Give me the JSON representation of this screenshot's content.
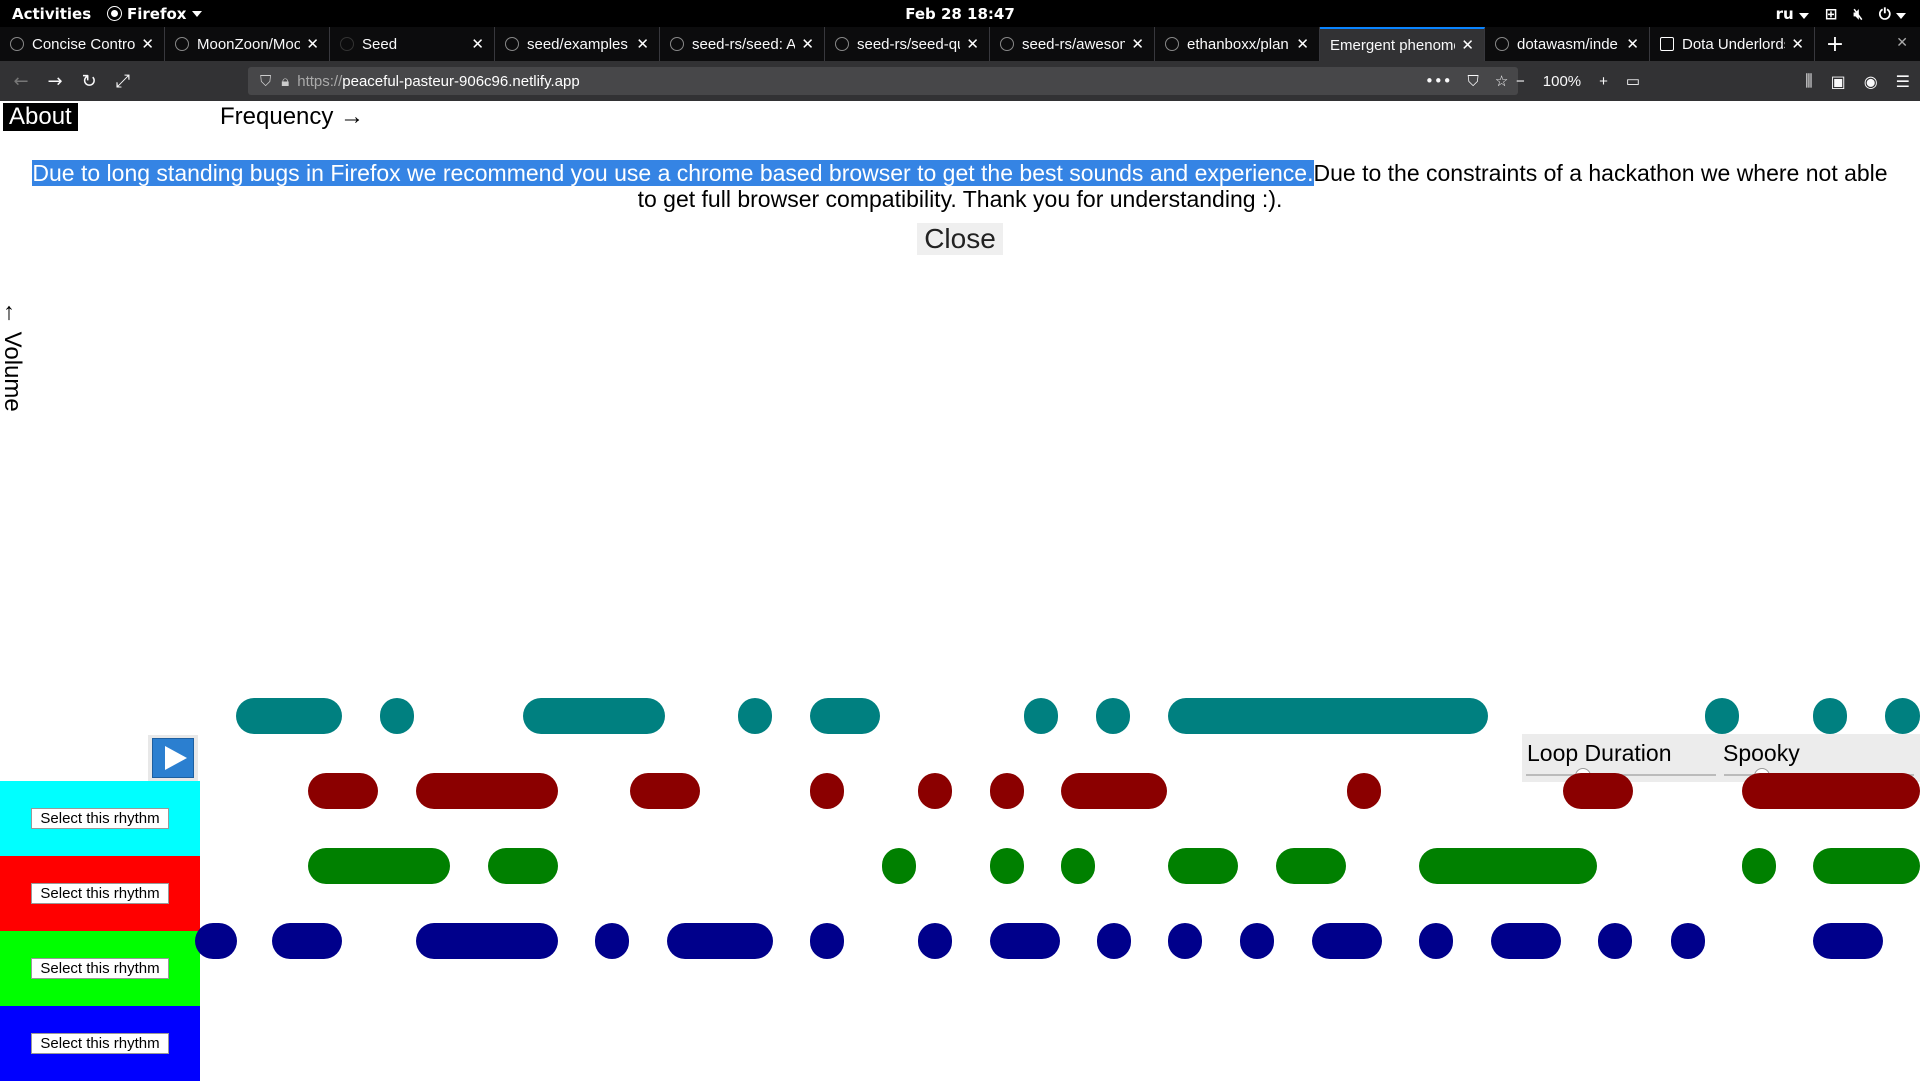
{
  "system_bar": {
    "activities": "Activities",
    "app_name": "Firefox",
    "clock": "Feb 28  18:47",
    "keyboard_layout": "ru"
  },
  "tabs": [
    {
      "title": "Concise Control",
      "active": false
    },
    {
      "title": "MoonZoon/Moo",
      "active": false
    },
    {
      "title": "Seed",
      "active": false
    },
    {
      "title": "seed/examples",
      "active": false
    },
    {
      "title": "seed-rs/seed: A",
      "active": false
    },
    {
      "title": "seed-rs/seed-qu",
      "active": false
    },
    {
      "title": "seed-rs/awesom",
      "active": false
    },
    {
      "title": "ethanboxx/plan",
      "active": false
    },
    {
      "title": "Emergent phenome",
      "active": true
    },
    {
      "title": "dotawasm/inde",
      "active": false
    },
    {
      "title": "Dota Underlords",
      "active": false
    }
  ],
  "address_bar": {
    "protocol": "https://",
    "host": "peaceful-pasteur-906c96.netlify.app",
    "zoom": "100%"
  },
  "page": {
    "about_label": "About",
    "frequency_label": "Frequency →",
    "volume_label": "← Volume",
    "notice_selected": "Due to long standing bugs in Firefox we recommend you use a chrome based browser to get the best sounds and experience.",
    "notice_rest": "Due to the constraints of a hackathon we where not able to get full browser compatibility. Thank you for understanding :).",
    "close_label": "Close",
    "loop_duration_label": "Loop Duration",
    "spooky_label": "Spooky",
    "loop_duration_value": 0.3,
    "spooky_value": 0.2
  },
  "rhythms": [
    {
      "label": "Select this rhythm",
      "row_color": "#00ffff",
      "note_color": "#008080"
    },
    {
      "label": "Select this rhythm",
      "row_color": "#ff0000",
      "note_color": "#8b0000"
    },
    {
      "label": "Select this rhythm",
      "row_color": "#00ff00",
      "note_color": "#008000"
    },
    {
      "label": "Select this rhythm",
      "row_color": "#0000ff",
      "note_color": "#00008b"
    }
  ]
}
